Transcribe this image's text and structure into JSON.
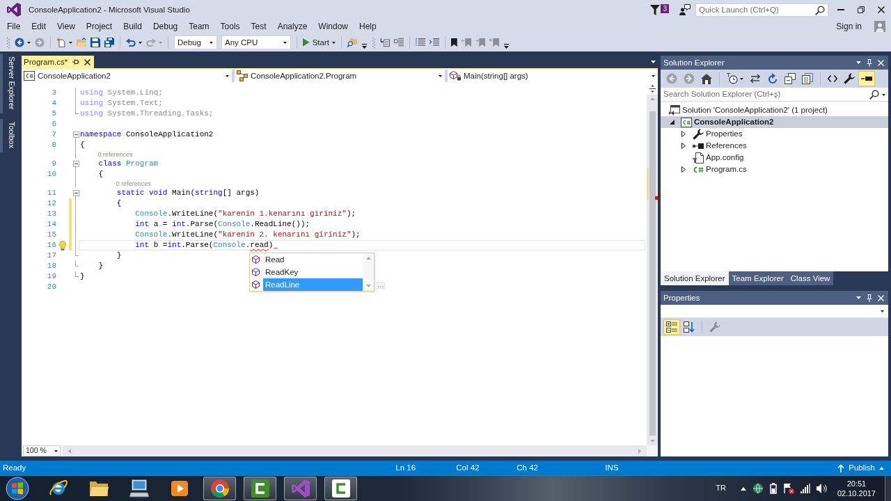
{
  "window": {
    "title": "ConsoleApplication2 - Microsoft Visual Studio",
    "notification_count": "3",
    "quick_launch": {
      "placeholder": "Quick Launch (Ctrl+Q)"
    }
  },
  "menu": [
    "File",
    "Edit",
    "View",
    "Project",
    "Build",
    "Debug",
    "Team",
    "Tools",
    "Test",
    "Analyze",
    "Window",
    "Help"
  ],
  "account": {
    "label": "Sign in"
  },
  "toolbar": [
    {
      "groups": [
        {
          "items": [
            {
              "kind": "back",
              "split": true,
              "disabled": false
            },
            {
              "kind": "forward",
              "split": false,
              "disabled": true
            }
          ]
        },
        {
          "items": [
            {
              "kind": "new",
              "split": true,
              "disabled": false
            },
            {
              "kind": "open",
              "split": false,
              "disabled": false
            },
            {
              "kind": "save",
              "split": false,
              "disabled": false
            },
            {
              "kind": "save_all",
              "split": false,
              "disabled": false
            }
          ]
        },
        {
          "items": [
            {
              "kind": "undo",
              "split": true,
              "disabled": false
            },
            {
              "kind": "redo",
              "split": true,
              "disabled": true
            }
          ]
        },
        {
          "items": [
            {
              "kind": "combo",
              "text": "Debug",
              "disabled": false
            },
            {
              "kind": "combo",
              "text": "Any CPU",
              "disabled": false
            }
          ]
        },
        {
          "items": [
            {
              "kind": "start",
              "text": "Start",
              "split": true,
              "disabled": false
            }
          ]
        },
        {
          "items": [
            {
              "kind": "find",
              "split": false,
              "disabled": false
            }
          ]
        }
      ]
    },
    {
      "groups": [
        {
          "items": [
            {
              "kind": "member_list",
              "split": false,
              "disabled": false
            },
            {
              "kind": "parameter_info",
              "split": false,
              "disabled": false
            }
          ]
        },
        {
          "items": [
            {
              "kind": "comment",
              "split": false,
              "disabled": false
            },
            {
              "kind": "uncomment",
              "split": false,
              "disabled": false
            }
          ]
        },
        {
          "items": [
            {
              "kind": "bookmark",
              "split": false,
              "disabled": false
            },
            {
              "kind": "bookmark_previous",
              "split": false,
              "disabled": true
            },
            {
              "kind": "bookmark_next",
              "split": false,
              "disabled": true
            },
            {
              "kind": "bookmark_clear",
              "split": false,
              "disabled": true
            }
          ]
        }
      ]
    }
  ],
  "side_tabs": [
    "Server Explorer",
    "Toolbox"
  ],
  "document_tabs": [
    {
      "label": "Program.cs*",
      "selected": true
    }
  ],
  "navigation": [
    {
      "kind": "project",
      "text": "ConsoleApplication2"
    },
    {
      "kind": "class",
      "text": "ConsoleApplication2.Program"
    },
    {
      "kind": "method",
      "text": "Main(string[] args)"
    }
  ],
  "editor": {
    "lines": [
      {
        "kind": "code",
        "number": "3",
        "tokens": [
          {
            "kind": "keyword_faded",
            "text": "using"
          },
          {
            "kind": "plain_faded",
            "text": " System.Linq;"
          }
        ],
        "outline": {
          "kind": "inside"
        },
        "changed": false,
        "current": false,
        "lightbulb": false
      },
      {
        "kind": "code",
        "number": "4",
        "tokens": [
          {
            "kind": "keyword_faded",
            "text": "using"
          },
          {
            "kind": "plain_faded",
            "text": " System.Text;"
          }
        ],
        "outline": {
          "kind": "inside"
        },
        "changed": false,
        "current": false,
        "lightbulb": false
      },
      {
        "kind": "code",
        "number": "5",
        "tokens": [
          {
            "kind": "keyword_faded",
            "text": "using"
          },
          {
            "kind": "plain_faded",
            "text": " System.Threading.Tasks;"
          }
        ],
        "outline": {
          "kind": "end"
        },
        "changed": false,
        "current": false,
        "lightbulb": false
      },
      {
        "kind": "code",
        "number": "6",
        "outline": {
          "kind": "none"
        },
        "changed": false,
        "current": false,
        "lightbulb": false
      },
      {
        "kind": "code",
        "number": "7",
        "tokens": [
          {
            "kind": "keyword",
            "text": "namespace"
          },
          {
            "kind": "plain",
            "text": " ConsoleApplication2"
          }
        ],
        "outline": {
          "kind": "start"
        },
        "changed": false,
        "current": false,
        "lightbulb": false
      },
      {
        "kind": "code",
        "number": "8",
        "tokens": [
          {
            "kind": "plain",
            "text": "{"
          }
        ],
        "outline": {
          "kind": "inside"
        },
        "changed": false,
        "current": false,
        "lightbulb": false
      },
      {
        "kind": "codelens",
        "text": "0 references",
        "outline": {
          "kind": "inside"
        }
      },
      {
        "kind": "code",
        "number": "9",
        "tokens": [
          {
            "kind": "keyword",
            "text": "    class "
          },
          {
            "kind": "type",
            "text": "Program"
          }
        ],
        "outline": {
          "kind": "start"
        },
        "changed": false,
        "current": false,
        "lightbulb": false
      },
      {
        "kind": "code",
        "number": "10",
        "tokens": [
          {
            "kind": "plain",
            "text": "    {"
          }
        ],
        "outline": {
          "kind": "inside"
        },
        "changed": false,
        "current": false,
        "lightbulb": false
      },
      {
        "kind": "codelens",
        "text": "0 references",
        "outline": {
          "kind": "inside"
        }
      },
      {
        "kind": "code",
        "number": "11",
        "tokens": [
          {
            "kind": "keyword",
            "text": "        static void"
          },
          {
            "kind": "plain",
            "text": " Main("
          },
          {
            "kind": "keyword",
            "text": "string"
          },
          {
            "kind": "plain",
            "text": "[] args)"
          }
        ],
        "outline": {
          "kind": "start"
        },
        "changed": false,
        "current": false,
        "lightbulb": false
      },
      {
        "kind": "code",
        "number": "12",
        "tokens": [
          {
            "kind": "plain",
            "text": "        {"
          }
        ],
        "outline": {
          "kind": "inside"
        },
        "changed": true,
        "current": false,
        "lightbulb": false
      },
      {
        "kind": "code",
        "number": "13",
        "tokens": [
          {
            "kind": "type",
            "text": "            Console"
          },
          {
            "kind": "plain",
            "text": ".WriteLine("
          },
          {
            "kind": "string",
            "text": "\"karenin 1.kenarını giriniz\""
          },
          {
            "kind": "plain",
            "text": ");"
          }
        ],
        "outline": {
          "kind": "inside"
        },
        "changed": true,
        "current": false,
        "lightbulb": false
      },
      {
        "kind": "code",
        "number": "14",
        "tokens": [
          {
            "kind": "keyword",
            "text": "            int"
          },
          {
            "kind": "plain",
            "text": " a = "
          },
          {
            "kind": "keyword",
            "text": "int"
          },
          {
            "kind": "plain",
            "text": ".Parse("
          },
          {
            "kind": "type",
            "text": "Console"
          },
          {
            "kind": "plain",
            "text": ".ReadLine());"
          }
        ],
        "outline": {
          "kind": "inside"
        },
        "changed": true,
        "current": false,
        "lightbulb": false
      },
      {
        "kind": "code",
        "number": "15",
        "tokens": [
          {
            "kind": "type",
            "text": "            Console"
          },
          {
            "kind": "plain",
            "text": ".WriteLine("
          },
          {
            "kind": "string",
            "text": "\"karenin 2. kenarını giriniz\""
          },
          {
            "kind": "plain",
            "text": ");"
          }
        ],
        "outline": {
          "kind": "inside"
        },
        "changed": true,
        "current": false,
        "lightbulb": false
      },
      {
        "kind": "code",
        "number": "16",
        "tokens": [
          {
            "kind": "keyword",
            "text": "            int"
          },
          {
            "kind": "plain",
            "text": " b ="
          },
          {
            "kind": "keyword",
            "text": "int"
          },
          {
            "kind": "plain",
            "text": ".Parse("
          },
          {
            "kind": "type",
            "text": "Console"
          },
          {
            "kind": "plain",
            "text": "."
          },
          {
            "kind": "error",
            "text": "read"
          },
          {
            "kind": "plain",
            "text": ")"
          },
          {
            "kind": "squiggle"
          }
        ],
        "outline": {
          "kind": "inside"
        },
        "changed": true,
        "current": true,
        "lightbulb": true
      },
      {
        "kind": "code",
        "number": "17",
        "tokens": [
          {
            "kind": "plain",
            "text": "        }"
          }
        ],
        "outline": {
          "kind": "end"
        },
        "changed": false,
        "current": false,
        "lightbulb": false
      },
      {
        "kind": "code",
        "number": "18",
        "tokens": [
          {
            "kind": "plain",
            "text": "    }"
          }
        ],
        "outline": {
          "kind": "end"
        },
        "changed": false,
        "current": false,
        "lightbulb": false
      },
      {
        "kind": "code",
        "number": "19",
        "tokens": [
          {
            "kind": "plain",
            "text": "}"
          }
        ],
        "outline": {
          "kind": "end"
        },
        "changed": false,
        "current": false,
        "lightbulb": false
      },
      {
        "kind": "code",
        "number": "20",
        "outline": {
          "kind": "none"
        },
        "changed": false,
        "current": false,
        "lightbulb": false
      }
    ],
    "completion": {
      "items": [
        {
          "label": "Read",
          "selected": false
        },
        {
          "label": "ReadKey",
          "selected": false
        },
        {
          "label": "ReadLine",
          "selected": true
        }
      ]
    },
    "zoom": "100 %"
  },
  "solution_explorer": {
    "title": "Solution Explorer",
    "toolbar": [
      {
        "items": [
          {
            "kind": "back",
            "split": false,
            "disabled": true,
            "on": false
          },
          {
            "kind": "forward",
            "split": false,
            "disabled": true,
            "on": false
          },
          {
            "kind": "home",
            "split": false,
            "disabled": false,
            "on": false
          }
        ]
      },
      {
        "items": [
          {
            "kind": "pending_changes",
            "split": true,
            "disabled": false,
            "on": false
          },
          {
            "kind": "sync",
            "split": false,
            "disabled": false,
            "on": false
          },
          {
            "kind": "refresh",
            "split": false,
            "disabled": false,
            "on": false
          },
          {
            "kind": "collapse_all",
            "split": false,
            "disabled": false,
            "on": false
          },
          {
            "kind": "show_all_files",
            "split": false,
            "disabled": false,
            "on": false
          }
        ]
      },
      {
        "items": [
          {
            "kind": "view_code",
            "split": false,
            "disabled": false,
            "on": false
          },
          {
            "kind": "properties",
            "split": false,
            "disabled": false,
            "on": false
          },
          {
            "kind": "preview",
            "split": false,
            "disabled": false,
            "on": true
          }
        ]
      }
    ],
    "search": {
      "placeholder": "Search Solution Explorer (Ctrl+ş)"
    },
    "tree": [
      {
        "label": "Solution 'ConsoleApplication2' (1 project)",
        "kind": "solution",
        "expandable": false,
        "expanded": true,
        "selected": false,
        "startup": false,
        "children": [
          {
            "label": "ConsoleApplication2",
            "kind": "project",
            "expandable": true,
            "expanded": true,
            "selected": true,
            "startup": true,
            "children": [
              {
                "label": "Properties",
                "kind": "properties",
                "expandable": true,
                "expanded": false,
                "selected": false,
                "startup": false
              },
              {
                "label": "References",
                "kind": "references",
                "expandable": true,
                "expanded": false,
                "selected": false,
                "startup": false
              },
              {
                "label": "App.config",
                "kind": "config",
                "expandable": false,
                "selected": false,
                "startup": false
              },
              {
                "label": "Program.cs",
                "kind": "code_file",
                "expandable": true,
                "expanded": false,
                "selected": false,
                "startup": false
              }
            ]
          }
        ]
      }
    ],
    "tabs": [
      {
        "label": "Solution Explorer",
        "selected": true
      },
      {
        "label": "Team Explorer",
        "selected": false
      },
      {
        "label": "Class View",
        "selected": false
      }
    ]
  },
  "properties": {
    "title": "Properties",
    "toolbar": [
      {
        "items": [
          {
            "kind": "categorized",
            "split": false,
            "disabled": false,
            "on": true
          },
          {
            "kind": "alphabetical",
            "split": false,
            "disabled": false,
            "on": false
          }
        ]
      },
      {
        "items": [
          {
            "kind": "property_pages",
            "split": false,
            "disabled": true,
            "on": false
          }
        ]
      }
    ]
  },
  "status_bar": {
    "message": "Ready",
    "line": "Ln 16",
    "column": "Col 42",
    "character": "Ch 42",
    "mode": "INS",
    "publish": "Publish"
  },
  "taskbar": {
    "apps": [
      {
        "kind": "internet_explorer",
        "running": false
      },
      {
        "kind": "explorer",
        "running": false
      },
      {
        "kind": "remote_desktop",
        "running": false
      },
      {
        "kind": "media_player",
        "running": false
      },
      {
        "kind": "chrome",
        "running": true
      },
      {
        "kind": "camtasia_studio",
        "running": true
      },
      {
        "kind": "visual_studio",
        "running": true
      },
      {
        "kind": "camtasia_recorder",
        "running": true
      }
    ],
    "tray": {
      "language": "TR",
      "time": "20:51",
      "date": "02.10.2017"
    }
  }
}
